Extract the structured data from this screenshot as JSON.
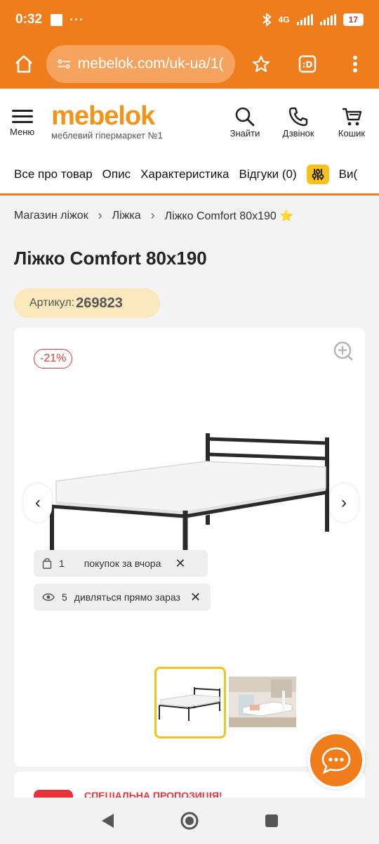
{
  "status": {
    "time": "0:32",
    "dots": "···",
    "network": "4G",
    "battery": "17"
  },
  "browser": {
    "url": "mebelok.com/uk-ua/1("
  },
  "header": {
    "menu_label": "Меню",
    "brand": "mebelok",
    "tagline": "меблевий гіпермаркет №1",
    "search_label": "Знайти",
    "call_label": "Дзвінок",
    "cart_label": "Кошик"
  },
  "tabs": [
    "Все про товар",
    "Опис",
    "Характеристика",
    "Відгуки (0)",
    "Ви("
  ],
  "breadcrumb": [
    "Магазин ліжок",
    "Ліжка",
    "Ліжко Comfort 80x190 ⭐"
  ],
  "product": {
    "title": "Ліжко Comfort 80x190",
    "sku_label": "Артикул:",
    "sku": "269823",
    "discount": "-21%",
    "purchases_count": "1",
    "purchases_text": "покупок за вчора",
    "viewing_count": "5",
    "viewing_text": "дивляться прямо зараз"
  },
  "promo": {
    "text": "СПЕЦІАЛЬНА ПРОПОЗИЦІЯ!"
  },
  "colors": {
    "accent": "#f07d1c",
    "brand": "#f39317",
    "promo_red": "#e8333b"
  }
}
